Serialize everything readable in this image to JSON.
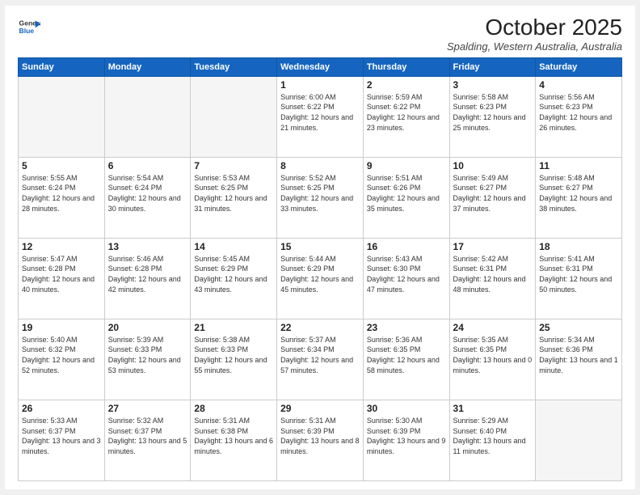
{
  "header": {
    "logo_line1": "General",
    "logo_line2": "Blue",
    "month": "October 2025",
    "location": "Spalding, Western Australia, Australia"
  },
  "days_of_week": [
    "Sunday",
    "Monday",
    "Tuesday",
    "Wednesday",
    "Thursday",
    "Friday",
    "Saturday"
  ],
  "weeks": [
    [
      {
        "day": "",
        "info": ""
      },
      {
        "day": "",
        "info": ""
      },
      {
        "day": "",
        "info": ""
      },
      {
        "day": "1",
        "info": "Sunrise: 6:00 AM\nSunset: 6:22 PM\nDaylight: 12 hours\nand 21 minutes."
      },
      {
        "day": "2",
        "info": "Sunrise: 5:59 AM\nSunset: 6:22 PM\nDaylight: 12 hours\nand 23 minutes."
      },
      {
        "day": "3",
        "info": "Sunrise: 5:58 AM\nSunset: 6:23 PM\nDaylight: 12 hours\nand 25 minutes."
      },
      {
        "day": "4",
        "info": "Sunrise: 5:56 AM\nSunset: 6:23 PM\nDaylight: 12 hours\nand 26 minutes."
      }
    ],
    [
      {
        "day": "5",
        "info": "Sunrise: 5:55 AM\nSunset: 6:24 PM\nDaylight: 12 hours\nand 28 minutes."
      },
      {
        "day": "6",
        "info": "Sunrise: 5:54 AM\nSunset: 6:24 PM\nDaylight: 12 hours\nand 30 minutes."
      },
      {
        "day": "7",
        "info": "Sunrise: 5:53 AM\nSunset: 6:25 PM\nDaylight: 12 hours\nand 31 minutes."
      },
      {
        "day": "8",
        "info": "Sunrise: 5:52 AM\nSunset: 6:25 PM\nDaylight: 12 hours\nand 33 minutes."
      },
      {
        "day": "9",
        "info": "Sunrise: 5:51 AM\nSunset: 6:26 PM\nDaylight: 12 hours\nand 35 minutes."
      },
      {
        "day": "10",
        "info": "Sunrise: 5:49 AM\nSunset: 6:27 PM\nDaylight: 12 hours\nand 37 minutes."
      },
      {
        "day": "11",
        "info": "Sunrise: 5:48 AM\nSunset: 6:27 PM\nDaylight: 12 hours\nand 38 minutes."
      }
    ],
    [
      {
        "day": "12",
        "info": "Sunrise: 5:47 AM\nSunset: 6:28 PM\nDaylight: 12 hours\nand 40 minutes."
      },
      {
        "day": "13",
        "info": "Sunrise: 5:46 AM\nSunset: 6:28 PM\nDaylight: 12 hours\nand 42 minutes."
      },
      {
        "day": "14",
        "info": "Sunrise: 5:45 AM\nSunset: 6:29 PM\nDaylight: 12 hours\nand 43 minutes."
      },
      {
        "day": "15",
        "info": "Sunrise: 5:44 AM\nSunset: 6:29 PM\nDaylight: 12 hours\nand 45 minutes."
      },
      {
        "day": "16",
        "info": "Sunrise: 5:43 AM\nSunset: 6:30 PM\nDaylight: 12 hours\nand 47 minutes."
      },
      {
        "day": "17",
        "info": "Sunrise: 5:42 AM\nSunset: 6:31 PM\nDaylight: 12 hours\nand 48 minutes."
      },
      {
        "day": "18",
        "info": "Sunrise: 5:41 AM\nSunset: 6:31 PM\nDaylight: 12 hours\nand 50 minutes."
      }
    ],
    [
      {
        "day": "19",
        "info": "Sunrise: 5:40 AM\nSunset: 6:32 PM\nDaylight: 12 hours\nand 52 minutes."
      },
      {
        "day": "20",
        "info": "Sunrise: 5:39 AM\nSunset: 6:33 PM\nDaylight: 12 hours\nand 53 minutes."
      },
      {
        "day": "21",
        "info": "Sunrise: 5:38 AM\nSunset: 6:33 PM\nDaylight: 12 hours\nand 55 minutes."
      },
      {
        "day": "22",
        "info": "Sunrise: 5:37 AM\nSunset: 6:34 PM\nDaylight: 12 hours\nand 57 minutes."
      },
      {
        "day": "23",
        "info": "Sunrise: 5:36 AM\nSunset: 6:35 PM\nDaylight: 12 hours\nand 58 minutes."
      },
      {
        "day": "24",
        "info": "Sunrise: 5:35 AM\nSunset: 6:35 PM\nDaylight: 13 hours\nand 0 minutes."
      },
      {
        "day": "25",
        "info": "Sunrise: 5:34 AM\nSunset: 6:36 PM\nDaylight: 13 hours\nand 1 minute."
      }
    ],
    [
      {
        "day": "26",
        "info": "Sunrise: 5:33 AM\nSunset: 6:37 PM\nDaylight: 13 hours\nand 3 minutes."
      },
      {
        "day": "27",
        "info": "Sunrise: 5:32 AM\nSunset: 6:37 PM\nDaylight: 13 hours\nand 5 minutes."
      },
      {
        "day": "28",
        "info": "Sunrise: 5:31 AM\nSunset: 6:38 PM\nDaylight: 13 hours\nand 6 minutes."
      },
      {
        "day": "29",
        "info": "Sunrise: 5:31 AM\nSunset: 6:39 PM\nDaylight: 13 hours\nand 8 minutes."
      },
      {
        "day": "30",
        "info": "Sunrise: 5:30 AM\nSunset: 6:39 PM\nDaylight: 13 hours\nand 9 minutes."
      },
      {
        "day": "31",
        "info": "Sunrise: 5:29 AM\nSunset: 6:40 PM\nDaylight: 13 hours\nand 11 minutes."
      },
      {
        "day": "",
        "info": ""
      }
    ]
  ]
}
